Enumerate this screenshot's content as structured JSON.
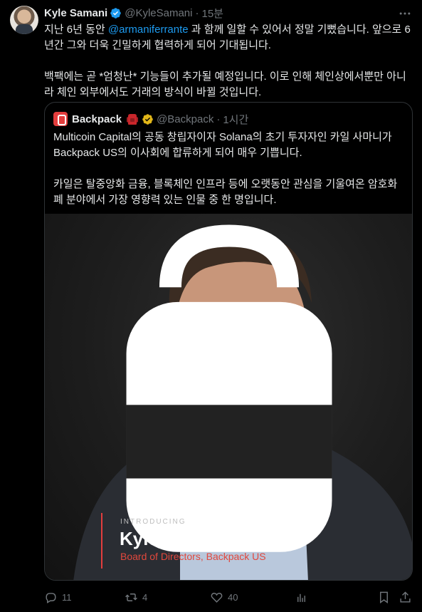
{
  "tweet": {
    "author_name": "Kyle Samani",
    "handle": "@KyleSamani",
    "separator": "·",
    "time": "15분",
    "text_part1": "지난 6년 동안 ",
    "mention": "@armaniferrante",
    "text_part2": " 과 함께 일할 수 있어서 정말 기뻤습니다. 앞으로 6년간 그와 더욱 긴밀하게 협력하게 되어 기대됩니다.",
    "text_para2": "백팩에는 곧 *엄청난* 기능들이 추가될 예정입니다. 이로 인해 체인상에서뿐만 아니라 체인 외부에서도 거래의 방식이 바뀔 것입니다."
  },
  "quote": {
    "author_name": "Backpack",
    "handle": "@Backpack",
    "separator": "·",
    "time": "1시간",
    "para1": "Multicoin Capital의 공동 창립자이자 Solana의 초기 투자자인 카일 사마니가 Backpack US의 이사회에 합류하게 되어 매우 기쁩니다.",
    "para2": "카일은 탈중앙화 금융, 블록체인 인프라 등에 오랫동안 관심을 기울여온 암호화폐 분야에서 가장 영향력 있는 인물 중 한 명입니다.",
    "image": {
      "intro_label": "INTRODUCING",
      "intro_name": "Kyle Samani",
      "intro_role": "Board of Directors, Backpack US"
    }
  },
  "actions": {
    "replies": "11",
    "retweets": "4",
    "likes": "40"
  },
  "colors": {
    "accent_blue": "#1d9bf0",
    "backpack_red": "#e33d3d",
    "muted": "#71767b"
  },
  "icons": [
    "verified-badge-icon",
    "more-icon",
    "backpack-bag-icon",
    "gold-verified-icon",
    "reply-icon",
    "retweet-icon",
    "like-icon",
    "views-icon",
    "bookmark-icon",
    "share-icon"
  ]
}
